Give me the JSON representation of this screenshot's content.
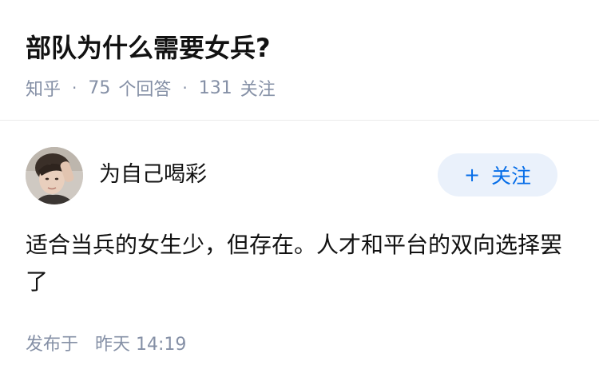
{
  "question": {
    "title": "部队为什么需要女兵?",
    "source": "知乎",
    "separator": "·",
    "answer_count": "75",
    "answer_label": "个回答",
    "follower_count": "131",
    "follower_label": "关注"
  },
  "answer": {
    "author": {
      "name": "为自己喝彩",
      "avatar_icon": "user-avatar"
    },
    "follow_button": {
      "icon": "+",
      "label": "关注"
    },
    "content": "适合当兵的女生少，但存在。人才和平台的双向选择罢了",
    "time": {
      "label": "发布于",
      "value": "昨天 14:19"
    }
  },
  "colors": {
    "accent": "#056de8",
    "follow_bg": "#eaf1fb",
    "meta_text": "#8590a6",
    "main_text": "#121212",
    "divider": "#ebebeb"
  }
}
